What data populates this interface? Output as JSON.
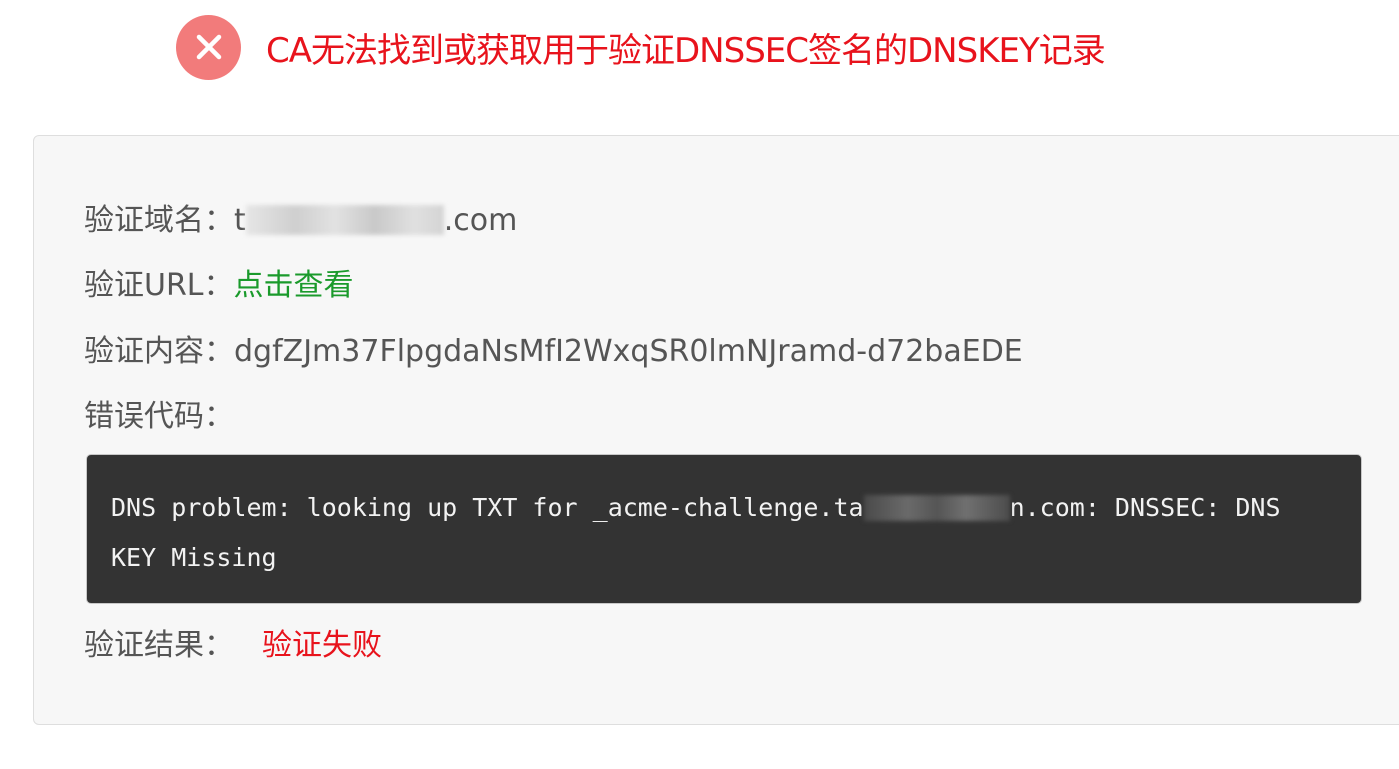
{
  "header": {
    "title": "CA无法找到或获取用于验证DNSSEC签名的DNSKEY记录",
    "icon": "error-x-icon",
    "icon_color": "#f27b7b",
    "title_color": "#e8131c"
  },
  "details": {
    "domain_label": "验证域名：",
    "domain_prefix": "t",
    "domain_suffix": ".com",
    "url_label": "验证URL：",
    "url_link": "点击查看",
    "content_label": "验证内容：",
    "content_value": "dgfZJm37FlpgdaNsMfI2WxqSR0lmNJramd-d72baEDE",
    "code_label": "错误代码：",
    "error_code_line1_prefix": "DNS problem: looking up TXT for _acme-challenge.ta",
    "error_code_line1_suffix": "n.com: DNSSEC: DNS",
    "error_code_line2": "KEY Missing",
    "result_label": "验证结果：",
    "result_value": "验证失败"
  },
  "colors": {
    "link": "#1a9a2b",
    "fail": "#e8131c",
    "code_bg": "#333333",
    "panel_bg": "#f7f7f7"
  }
}
